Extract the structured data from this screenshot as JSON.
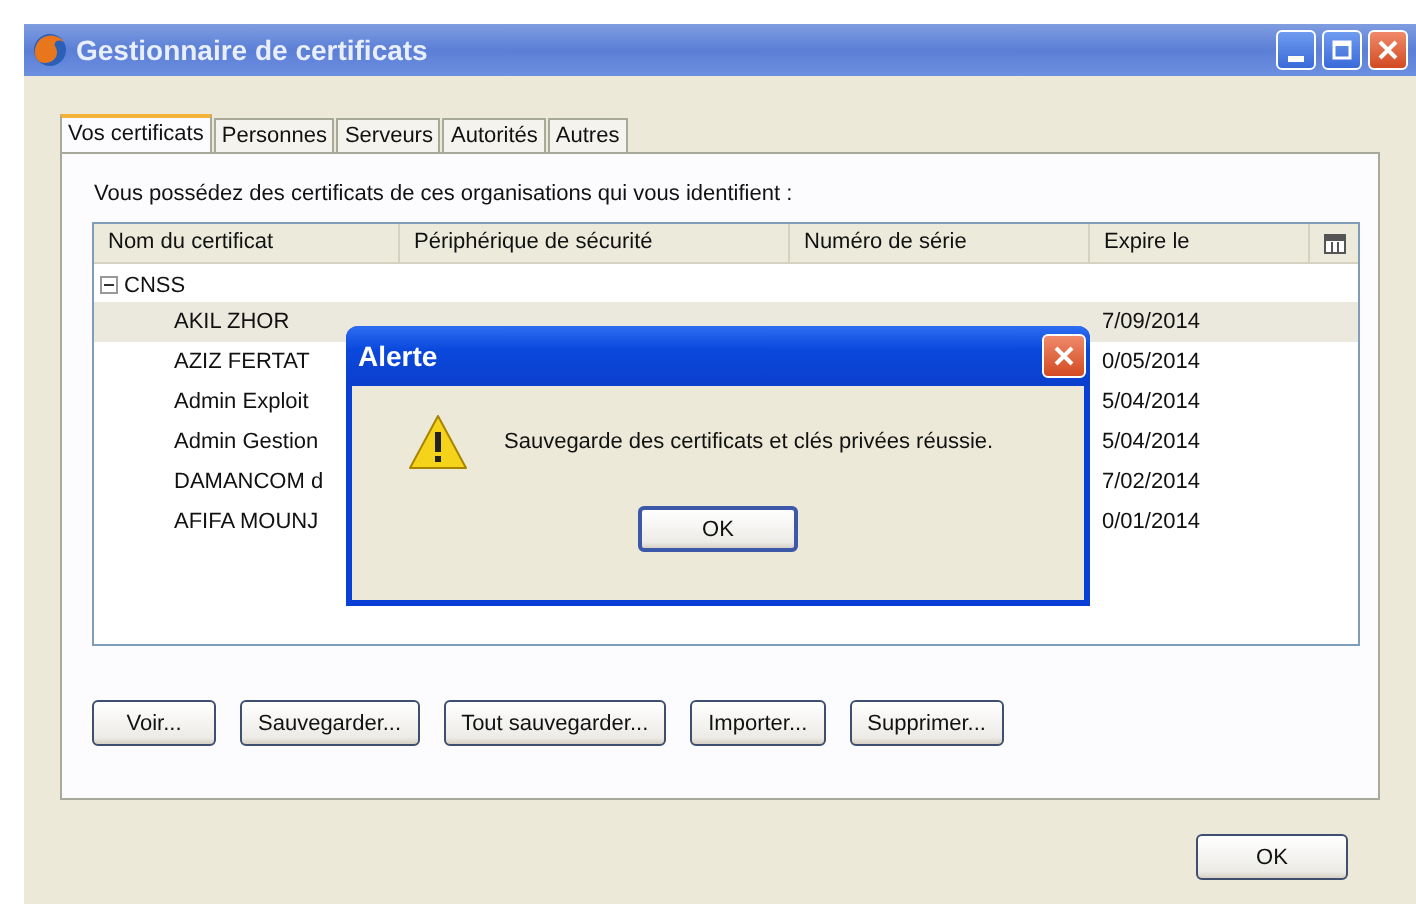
{
  "window": {
    "title": "Gestionnaire de certificats"
  },
  "tabs": [
    {
      "label": "Vos certificats",
      "selected": true
    },
    {
      "label": "Personnes",
      "selected": false
    },
    {
      "label": "Serveurs",
      "selected": false
    },
    {
      "label": "Autorités",
      "selected": false
    },
    {
      "label": "Autres",
      "selected": false
    }
  ],
  "description": "Vous possédez des certificats de ces organisations qui vous identifient :",
  "table": {
    "columns": [
      "Nom du certificat",
      "Périphérique de sécurité",
      "Numéro de série",
      "Expire le"
    ],
    "groups": [
      {
        "name": "CNSS",
        "expanded": true,
        "children": [
          {
            "name": "AKIL ZHOR",
            "expires": "7/09/2014",
            "selected": true
          },
          {
            "name": "AZIZ FERTAT",
            "expires": "0/05/2014",
            "selected": false
          },
          {
            "name": "Admin Exploit",
            "expires": "5/04/2014",
            "selected": false
          },
          {
            "name": "Admin Gestion",
            "expires": "5/04/2014",
            "selected": false
          },
          {
            "name": "DAMANCOM d",
            "expires": "7/02/2014",
            "selected": false
          },
          {
            "name": "AFIFA MOUNJ",
            "expires": "0/01/2014",
            "selected": false
          }
        ]
      }
    ]
  },
  "buttons": [
    "Voir...",
    "Sauvegarder...",
    "Tout sauvegarder...",
    "Importer...",
    "Supprimer..."
  ],
  "ok_button": "OK",
  "alert": {
    "title": "Alerte",
    "message": "Sauvegarde des certificats et clés privées réussie.",
    "button": "OK"
  }
}
